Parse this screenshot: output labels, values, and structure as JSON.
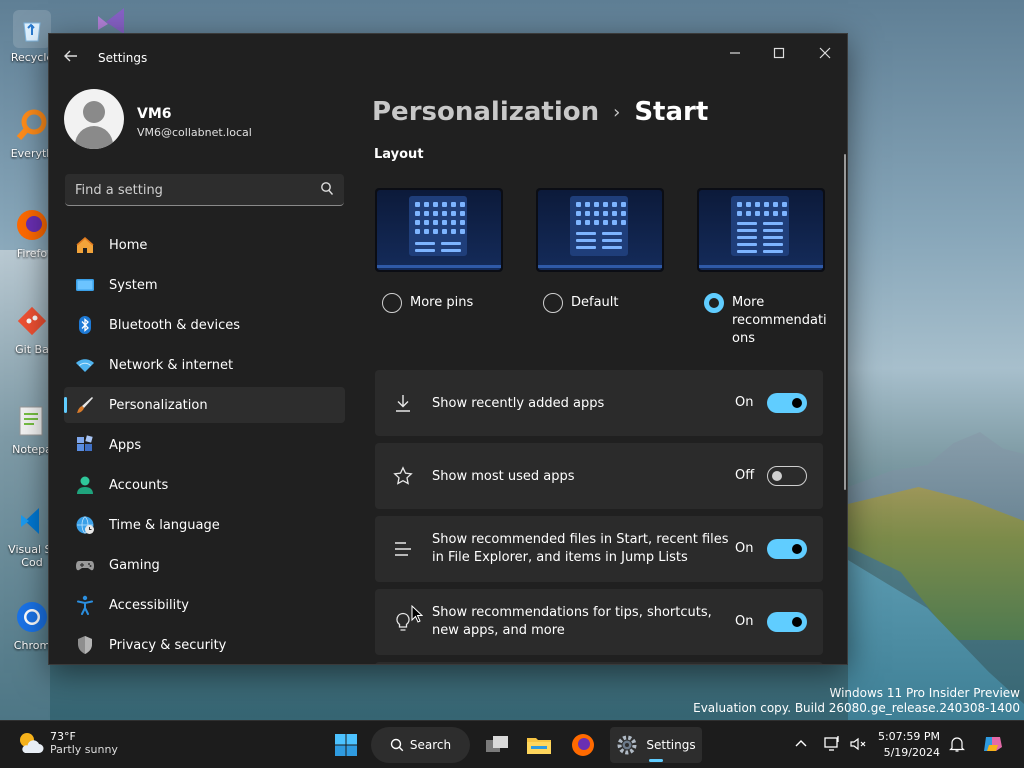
{
  "desktop": {
    "icons": [
      {
        "label": "Recycle",
        "color": "#cfe8ff"
      },
      {
        "label": "Everyth",
        "color": "#ff8c1a"
      },
      {
        "label": "Firefo",
        "color": "#ff6a00"
      },
      {
        "label": "Git Ba",
        "color": "#f05133"
      },
      {
        "label": "Notepa",
        "color": "#77c043"
      },
      {
        "label": "Visual St",
        "label2": "Cod",
        "color": "#0078d4"
      },
      {
        "label": "Chrom",
        "color": "#1a73e8"
      }
    ],
    "watermark_line1": "Windows 11 Pro Insider Preview",
    "watermark_line2": "Evaluation copy. Build 26080.ge_release.240308-1400"
  },
  "window": {
    "title": "Settings",
    "controls": {
      "minimize": "—",
      "maximize": "☐",
      "close": "✕"
    }
  },
  "profile": {
    "name": "VM6",
    "email": "VM6@collabnet.local"
  },
  "search": {
    "placeholder": "Find a setting"
  },
  "nav": {
    "items": [
      {
        "label": "Home",
        "icon": "home-icon"
      },
      {
        "label": "System",
        "icon": "monitor-icon"
      },
      {
        "label": "Bluetooth & devices",
        "icon": "bluetooth-icon"
      },
      {
        "label": "Network & internet",
        "icon": "wifi-icon"
      },
      {
        "label": "Personalization",
        "icon": "brush-icon",
        "selected": true
      },
      {
        "label": "Apps",
        "icon": "apps-icon"
      },
      {
        "label": "Accounts",
        "icon": "person-icon"
      },
      {
        "label": "Time & language",
        "icon": "globe-clock-icon"
      },
      {
        "label": "Gaming",
        "icon": "gamepad-icon"
      },
      {
        "label": "Accessibility",
        "icon": "accessibility-icon"
      },
      {
        "label": "Privacy & security",
        "icon": "shield-icon"
      }
    ]
  },
  "content": {
    "breadcrumb_parent": "Personalization",
    "breadcrumb_sep": "›",
    "breadcrumb_current": "Start",
    "layout_label": "Layout",
    "layouts": [
      {
        "label": "More pins",
        "checked": false
      },
      {
        "label": "Default",
        "checked": false
      },
      {
        "label": "More recommendati",
        "label2": "ons",
        "checked": true
      }
    ],
    "settings": [
      {
        "label": "Show recently added apps",
        "label2": "",
        "state": "On",
        "icon": "download-icon"
      },
      {
        "label": "Show most used apps",
        "label2": "",
        "state": "Off",
        "icon": "star-icon"
      },
      {
        "label": "Show recommended files in Start, recent files",
        "label2": "in File Explorer, and items in Jump Lists",
        "state": "On",
        "icon": "list-lines-icon"
      },
      {
        "label": "Show recommendations for tips, shortcuts,",
        "label2": "new apps, and more",
        "state": "On",
        "icon": "lightbulb-icon"
      }
    ]
  },
  "taskbar": {
    "weather_temp": "73°F",
    "weather_cond": "Partly sunny",
    "search_label": "Search",
    "settings_label": "Settings",
    "time": "5:07:59 PM",
    "date": "5/19/2024",
    "accent": "#60cdff"
  }
}
